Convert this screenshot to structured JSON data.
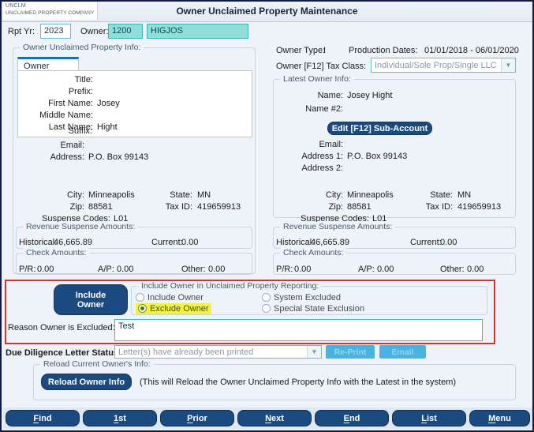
{
  "window": {
    "title": "Owner Unclaimed Property Maintenance",
    "logo_line1": "UNCLM",
    "logo_line2": "UNCLAIMED PROPERTY COMPANY"
  },
  "header": {
    "rpt_yr_label": "Rpt Yr:",
    "rpt_yr_value": "2023",
    "owner_label": "Owner:",
    "owner_number": "1200",
    "owner_code": "HIGJOS"
  },
  "left_panel": {
    "caption": "Owner Unclaimed Property Info:",
    "tab_label": "Owner Name",
    "fields": [
      {
        "label": "Title:",
        "value": ""
      },
      {
        "label": "Prefix:",
        "value": ""
      },
      {
        "label": "First Name:",
        "value": "Josey"
      },
      {
        "label": "Middle Name:",
        "value": ""
      },
      {
        "label": "Last Name:",
        "value": "Hight"
      },
      {
        "label": "Suffix:",
        "value": ""
      }
    ],
    "email_label": "Email:",
    "email_value": "",
    "address_label": "Address:",
    "address_value": "P.O. Box 99143",
    "city_label": "City:",
    "city_value": "Minneapolis",
    "state_label": "State:",
    "state_value": "MN",
    "zip_label": "Zip:",
    "zip_value": "88581",
    "tax_id_label": "Tax ID:",
    "tax_id_value": "419659913",
    "suspense_codes_label": "Suspense Codes:",
    "suspense_codes_value": "L01",
    "revenue_caption": "Revenue Suspense Amounts:",
    "historical_label": "Historical:",
    "historical_value": "46,665.89",
    "current_label": "Current:",
    "current_value": "0.00",
    "check_caption": "Check Amounts:",
    "pr_label": "P/R:",
    "pr_value": "0.00",
    "ap_label": "A/P:",
    "ap_value": "0.00",
    "other_label": "Other:",
    "other_value": "0.00"
  },
  "right_panel": {
    "owner_type_label": "Owner Type:",
    "owner_type_value": "I",
    "production_dates_label": "Production Dates:",
    "production_dates_value": "01/01/2018 - 06/01/2020",
    "tax_class_label": "Owner [F12] Tax Class:",
    "tax_class_value": "Individual/Sole Prop/Single LLC",
    "latest_caption": "Latest Owner Info:",
    "name_label": "Name:",
    "name_value": "Josey Hight",
    "name2_label": "Name #2:",
    "name2_value": "",
    "edit_sub_account_button": "Edit [F12] Sub-Account",
    "email_label": "Email:",
    "email_value": "",
    "address1_label": "Address 1:",
    "address1_value": "P.O. Box 99143",
    "address2_label": "Address 2:",
    "address2_value": "",
    "city_label": "City:",
    "city_value": "Minneapolis",
    "state_label": "State:",
    "state_value": "MN",
    "zip_label": "Zip:",
    "zip_value": "88581",
    "tax_id_label": "Tax ID:",
    "tax_id_value": "419659913",
    "suspense_codes_label": "Suspense Codes:",
    "suspense_codes_value": "L01",
    "revenue_caption": "Revenue Suspense Amounts:",
    "historical_label": "Historical:",
    "historical_value": "46,665.89",
    "current_label": "Current:",
    "current_value": "0.00",
    "check_caption": "Check Amounts:",
    "pr_label": "P/R:",
    "pr_value": "0.00",
    "ap_label": "A/P:",
    "ap_value": "0.00",
    "other_label": "Other:",
    "other_value": "0.00"
  },
  "exclusion": {
    "include_owner_button": "Include\nOwner",
    "include_owner_button_line1": "Include",
    "include_owner_button_line2": "Owner",
    "group_caption": "Include Owner in Unclaimed Property Reporting:",
    "options": [
      {
        "label": "Include Owner",
        "selected": false,
        "highlighted": false
      },
      {
        "label": "Exclude Owner",
        "selected": true,
        "highlighted": true
      },
      {
        "label": "System Excluded",
        "selected": false,
        "highlighted": false
      },
      {
        "label": "Special State Exclusion",
        "selected": false,
        "highlighted": false
      }
    ],
    "reason_label": "Reason Owner is Excluded:",
    "reason_value": "Test"
  },
  "due_diligence": {
    "status_label": "Due Diligence Letter Status:",
    "status_value": "Letter(s) have already been printed",
    "reprint_button": "Re-Print",
    "email_button": "Email"
  },
  "reload": {
    "caption": "Reload Current Owner's Info:",
    "button": "Reload Owner Info",
    "note": "(This will Reload the Owner Unclaimed Property Info with the Latest in the system)"
  },
  "navbar": {
    "buttons": [
      {
        "pre": "",
        "key": "F",
        "post": "ind"
      },
      {
        "pre": "",
        "key": "1",
        "post": "st"
      },
      {
        "pre": "",
        "key": "P",
        "post": "rior"
      },
      {
        "pre": "",
        "key": "N",
        "post": "ext"
      },
      {
        "pre": "",
        "key": "E",
        "post": "nd"
      },
      {
        "pre": "",
        "key": "L",
        "post": "ist"
      },
      {
        "pre": "",
        "key": "M",
        "post": "enu"
      }
    ]
  },
  "colors": {
    "navy": "#1b4a80",
    "teal_field": "#8fdedc",
    "highlight_yellow": "#f3f33a",
    "red_outline": "#d0342c",
    "disabled_button": "#46b5e6"
  }
}
